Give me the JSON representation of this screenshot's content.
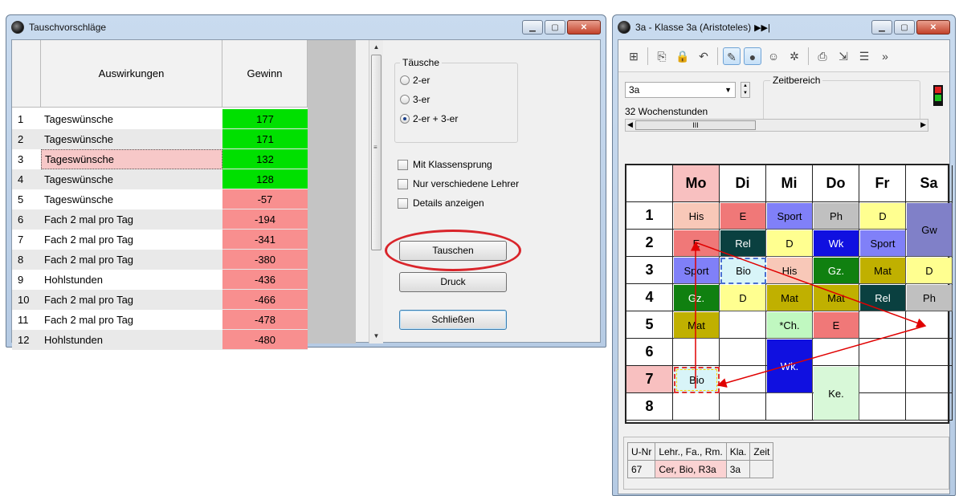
{
  "left_window": {
    "title": "Tauschvorschläge",
    "columns": [
      "Auswirkungen",
      "Gewinn"
    ],
    "rows": [
      {
        "num": "1",
        "label": "Tageswünsche",
        "gain": "177"
      },
      {
        "num": "2",
        "label": "Tageswünsche",
        "gain": "171"
      },
      {
        "num": "3",
        "label": "Tageswünsche",
        "gain": "132"
      },
      {
        "num": "4",
        "label": "Tageswünsche",
        "gain": "128"
      },
      {
        "num": "5",
        "label": "Tageswünsche",
        "gain": "-57"
      },
      {
        "num": "6",
        "label": "Fach 2 mal pro Tag",
        "gain": "-194"
      },
      {
        "num": "7",
        "label": "Fach 2 mal pro Tag",
        "gain": "-341"
      },
      {
        "num": "8",
        "label": "Fach 2 mal pro Tag",
        "gain": "-380"
      },
      {
        "num": "9",
        "label": "Hohlstunden",
        "gain": "-436"
      },
      {
        "num": "10",
        "label": "Fach 2 mal pro Tag",
        "gain": "-466"
      },
      {
        "num": "11",
        "label": "Fach 2 mal pro Tag",
        "gain": "-478"
      },
      {
        "num": "12",
        "label": "Hohlstunden",
        "gain": "-480"
      }
    ],
    "selected_row": 3,
    "positive_color": "#00e000",
    "negative_color": "#f88f8f",
    "swap_group": {
      "title": "Täusche",
      "options": [
        "2-er",
        "3-er",
        "2-er + 3-er"
      ],
      "selected": "2-er + 3-er"
    },
    "checkboxes": [
      "Mit Klassensprung",
      "Nur verschiedene Lehrer",
      "Details anzeigen"
    ],
    "buttons": {
      "swap": "Tauschen",
      "print": "Druck",
      "close": "Schließen"
    }
  },
  "right_window": {
    "title": "3a - Klasse 3a (Aristoteles)",
    "class_select": "3a",
    "zeitbereich_label": "Zeitbereich",
    "hours_label": "32  Wochenstunden",
    "hscroll_thumb": "III",
    "days": [
      "Mo",
      "Di",
      "Mi",
      "Do",
      "Fr",
      "Sa"
    ],
    "periods": [
      "1",
      "2",
      "3",
      "4",
      "5",
      "6",
      "7",
      "8"
    ],
    "lessons": [
      {
        "day": 0,
        "period": 0,
        "span": 1,
        "text": "His",
        "color": "#f8c8b8"
      },
      {
        "day": 1,
        "period": 0,
        "span": 1,
        "text": "E",
        "color": "#f07878"
      },
      {
        "day": 2,
        "period": 0,
        "span": 1,
        "text": "Sport",
        "color": "#8080f8"
      },
      {
        "day": 3,
        "period": 0,
        "span": 1,
        "text": "Ph",
        "color": "#c0c0c0"
      },
      {
        "day": 4,
        "period": 0,
        "span": 1,
        "text": "D",
        "color": "#ffff90"
      },
      {
        "day": 5,
        "period": 0,
        "span": 2,
        "text": "Gw",
        "color": "#8080c8"
      },
      {
        "day": 0,
        "period": 1,
        "span": 1,
        "text": "E",
        "color": "#f07878"
      },
      {
        "day": 1,
        "period": 1,
        "span": 1,
        "text": "Rel",
        "color": "#0a4040"
      },
      {
        "day": 2,
        "period": 1,
        "span": 1,
        "text": "D",
        "color": "#ffff90"
      },
      {
        "day": 3,
        "period": 1,
        "span": 1,
        "text": "Wk",
        "color": "#1010e0"
      },
      {
        "day": 4,
        "period": 1,
        "span": 1,
        "text": "Sport",
        "color": "#8080f8"
      },
      {
        "day": 0,
        "period": 2,
        "span": 1,
        "text": "Sport",
        "color": "#8080f8"
      },
      {
        "day": 1,
        "period": 2,
        "span": 1,
        "text": "Bio",
        "color": "#d8f4f8"
      },
      {
        "day": 2,
        "period": 2,
        "span": 1,
        "text": "His",
        "color": "#f8c8b8"
      },
      {
        "day": 3,
        "period": 2,
        "span": 1,
        "text": "Gz.",
        "color": "#108010"
      },
      {
        "day": 4,
        "period": 2,
        "span": 1,
        "text": "Mat",
        "color": "#c0b000"
      },
      {
        "day": 5,
        "period": 2,
        "span": 1,
        "text": "D",
        "color": "#ffff90"
      },
      {
        "day": 0,
        "period": 3,
        "span": 1,
        "text": "Gz.",
        "color": "#108010"
      },
      {
        "day": 1,
        "period": 3,
        "span": 1,
        "text": "D",
        "color": "#ffff90"
      },
      {
        "day": 2,
        "period": 3,
        "span": 1,
        "text": "Mat",
        "color": "#c0b000"
      },
      {
        "day": 3,
        "period": 3,
        "span": 1,
        "text": "Mat",
        "color": "#c0b000"
      },
      {
        "day": 4,
        "period": 3,
        "span": 1,
        "text": "Rel",
        "color": "#0a4040"
      },
      {
        "day": 5,
        "period": 3,
        "span": 1,
        "text": "Ph",
        "color": "#c0c0c0"
      },
      {
        "day": 0,
        "period": 4,
        "span": 1,
        "text": "Mat",
        "color": "#c0b000"
      },
      {
        "day": 2,
        "period": 4,
        "span": 1,
        "text": "*Ch.",
        "color": "#c0f8c0"
      },
      {
        "day": 3,
        "period": 4,
        "span": 1,
        "text": "E",
        "color": "#f07878"
      },
      {
        "day": 2,
        "period": 5,
        "span": 2,
        "text": "Wk.",
        "color": "#1010e0"
      },
      {
        "day": 0,
        "period": 6,
        "span": 1,
        "text": "Bio",
        "color": "#d8f4f8"
      },
      {
        "day": 3,
        "period": 6,
        "span": 2,
        "text": "Ke.",
        "color": "#d8f8d8"
      }
    ],
    "info": {
      "headers": [
        "U-Nr",
        "Lehr., Fa., Rm.",
        "Kla.",
        "Zeit"
      ],
      "values": [
        "67",
        "Cer, Bio, R3a",
        "3a",
        ""
      ]
    }
  }
}
